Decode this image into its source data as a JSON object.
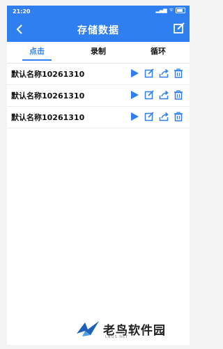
{
  "status_bar": {
    "time": "21:20",
    "signal": "46",
    "wifi": "ᯤ",
    "battery": ""
  },
  "app_bar": {
    "title": "存储数据"
  },
  "tabs": [
    {
      "label": "点击",
      "active": true
    },
    {
      "label": "录制",
      "active": false
    },
    {
      "label": "循环",
      "active": false
    }
  ],
  "rows": [
    {
      "name": "默认名称10261310"
    },
    {
      "name": "默认名称10261310"
    },
    {
      "name": "默认名称10261310"
    }
  ],
  "row_actions": [
    "play-icon",
    "edit-icon",
    "share-icon",
    "delete-icon"
  ],
  "watermark": {
    "brand": "老鸟软件园",
    "domain": "LNQS.NET"
  },
  "colors": {
    "accent": "#2f7ff0",
    "text": "#111111"
  }
}
